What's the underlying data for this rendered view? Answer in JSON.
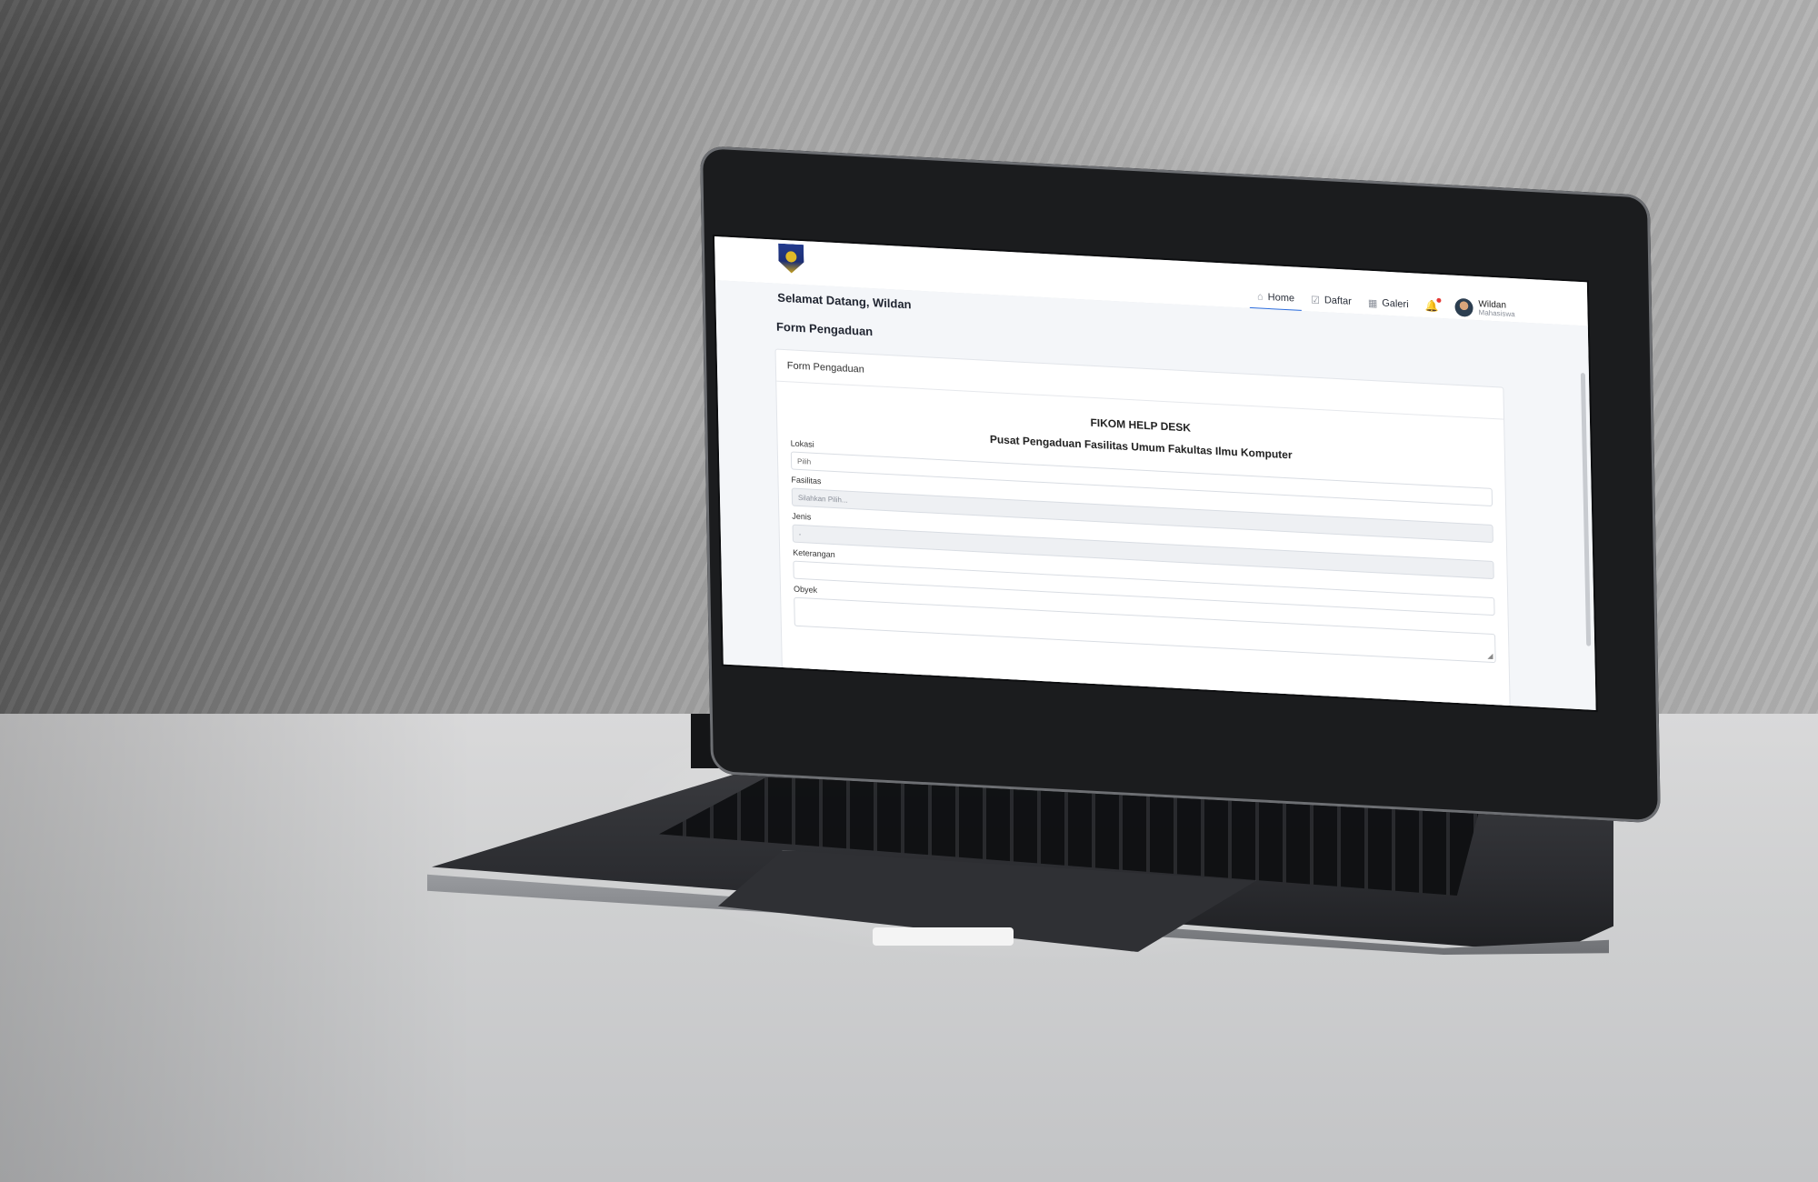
{
  "header": {
    "nav": [
      {
        "label": "Home",
        "icon": "home-icon",
        "active": true
      },
      {
        "label": "Daftar",
        "icon": "checklist-icon",
        "active": false
      },
      {
        "label": "Galeri",
        "icon": "grid-icon",
        "active": false
      }
    ],
    "user": {
      "name": "Wildan",
      "role": "Mahasiswa"
    }
  },
  "page": {
    "welcome": "Selamat Datang, Wildan",
    "title": "Form Pengaduan"
  },
  "card": {
    "header": "Form Pengaduan",
    "help_title": "FIKOM HELP DESK",
    "help_subtitle": "Pusat Pengaduan Fasilitas Umum Fakultas Ilmu Komputer",
    "fields": {
      "lokasi": {
        "label": "Lokasi",
        "value": "Pilih"
      },
      "fasilitas": {
        "label": "Fasilitas",
        "placeholder": "Silahkan Pilih..."
      },
      "jenis": {
        "label": "Jenis",
        "value": "-"
      },
      "keterangan": {
        "label": "Keterangan",
        "value": ""
      },
      "obyek": {
        "label": "Obyek",
        "value": ""
      }
    }
  },
  "colors": {
    "accent": "#2f6fde",
    "notification": "#e53935",
    "background": "#f4f6f9"
  }
}
